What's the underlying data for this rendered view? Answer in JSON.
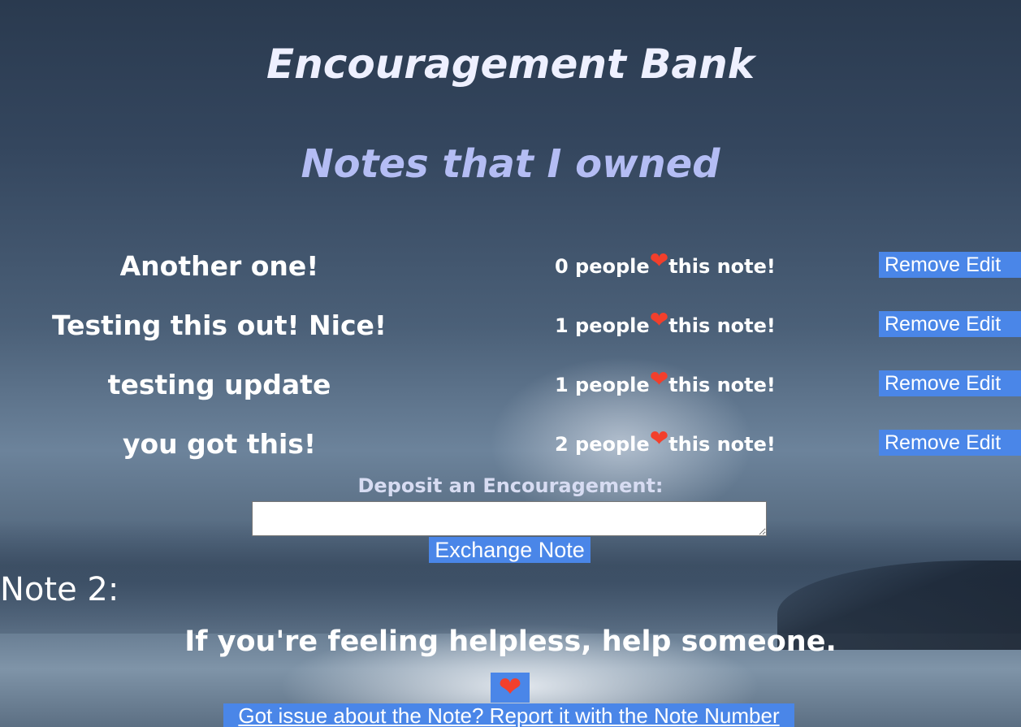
{
  "header": {
    "title": "Encouragement Bank",
    "section_title": "Notes that I owned"
  },
  "owned_notes": [
    {
      "text": "Another one!",
      "likes_count": "0",
      "likes_suffix": " people",
      "likes_tail": "this note!",
      "remove_label": "Remove",
      "edit_label": "Edit"
    },
    {
      "text": "Testing this out! Nice!",
      "likes_count": "1",
      "likes_suffix": " people",
      "likes_tail": "this note!",
      "remove_label": "Remove",
      "edit_label": "Edit"
    },
    {
      "text": "testing update",
      "likes_count": "1",
      "likes_suffix": " people",
      "likes_tail": "this note!",
      "remove_label": "Remove",
      "edit_label": "Edit"
    },
    {
      "text": "you got this!",
      "likes_count": "2",
      "likes_suffix": " people",
      "likes_tail": "this note!",
      "remove_label": "Remove",
      "edit_label": "Edit"
    }
  ],
  "deposit": {
    "label": "Deposit an Encouragement:",
    "input_value": "",
    "exchange_label": "Exchange Note"
  },
  "featured": {
    "note_number": "Note 2:",
    "text": "If you're feeling helpless, help someone.",
    "like_icon": "heart-icon",
    "report_label": "Got issue about the Note? Report it with the Note Number"
  },
  "colors": {
    "accent": "#4a86e8",
    "heart": "#f23f2c",
    "section_title": "#b4bdf4"
  }
}
